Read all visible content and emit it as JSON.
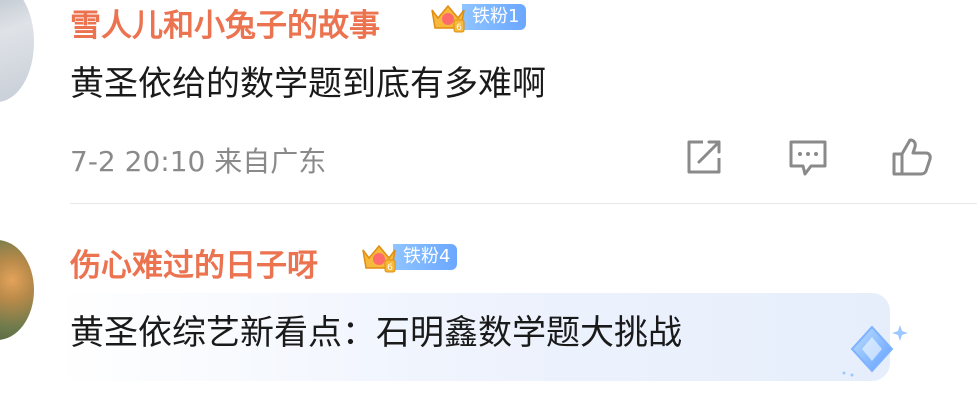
{
  "comments": [
    {
      "username": "雪人儿和小兔子的故事",
      "fan_badge": "铁粉1",
      "text": "黄圣依给的数学题到底有多难啊",
      "timestamp": "7-2 20:10",
      "location": "来自广东",
      "actions": [
        "share-icon",
        "reply-icon",
        "like-icon"
      ]
    },
    {
      "username": "伤心难过的日子呀",
      "fan_badge": "铁粉4",
      "text": "黄圣依综艺新看点：石明鑫数学题大挑战"
    }
  ],
  "colors": {
    "username": "#eb7350",
    "meta": "#8a8a8a",
    "text": "#1a1a1a",
    "fan_badge": "#7ab4ff",
    "divider": "#e8e8e8"
  }
}
